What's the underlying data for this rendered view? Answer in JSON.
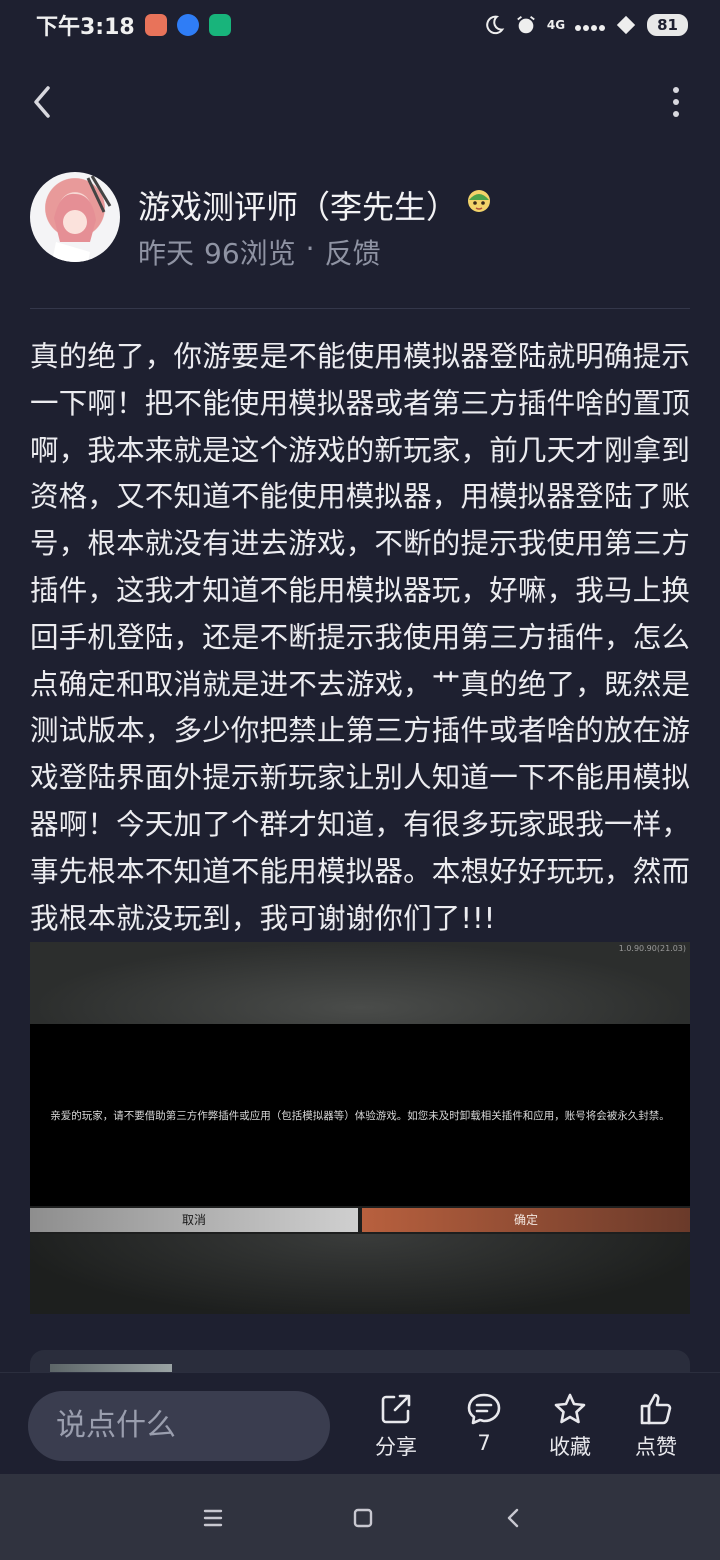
{
  "status_bar": {
    "time": "下午3:18",
    "network": "4G",
    "battery": "81"
  },
  "author": {
    "name": "游戏测评师（李先生）",
    "time": "昨天",
    "views": "96浏览",
    "separator": "·",
    "feedback": "反馈"
  },
  "post": {
    "body": "真的绝了，你游要是不能使用模拟器登陆就明确提示一下啊！把不能使用模拟器或者第三方插件啥的置顶啊，我本来就是这个游戏的新玩家，前几天才刚拿到资格，又不知道不能使用模拟器，用模拟器登陆了账号，根本就没有进去游戏，不断的提示我使用第三方插件，这我才知道不能用模拟器玩，好嘛，我马上换回手机登陆，还是不断提示我使用第三方插件，怎么点确定和取消就是进不去游戏，艹真的绝了，既然是测试版本，多少你把禁止第三方插件或者啥的放在游戏登陆界面外提示新玩家让别人知道一下不能用模拟器啊！今天加了个群才知道，有很多玩家跟我一样，事先根本不知道不能用模拟器。本想好好玩玩，然而我根本就没玩到，我可谢谢你们了!!!"
  },
  "screenshot": {
    "version": "1.0.90.90(21.03)",
    "message": "亲爱的玩家，请不要借助第三方作弊插件或应用（包括模拟器等）体验游戏。如您未及时卸载相关插件和应用，账号将会被永久封禁。",
    "cancel_label": "取消",
    "confirm_label": "确定"
  },
  "action_bar": {
    "comment_placeholder": "说点什么",
    "share_label": "分享",
    "comment_count": "7",
    "favorite_label": "收藏",
    "like_label": "点赞"
  },
  "icons": {
    "back": "chevron-left-icon",
    "more": "more-vertical-icon",
    "share": "share-icon",
    "comment": "comment-icon",
    "favorite": "star-icon",
    "like": "thumbs-up-icon"
  },
  "colors": {
    "background": "#1e2030",
    "text": "#ececf0",
    "muted": "#8f93a3",
    "input_bg": "#3a3d4f",
    "nav_bg": "#30333f"
  }
}
